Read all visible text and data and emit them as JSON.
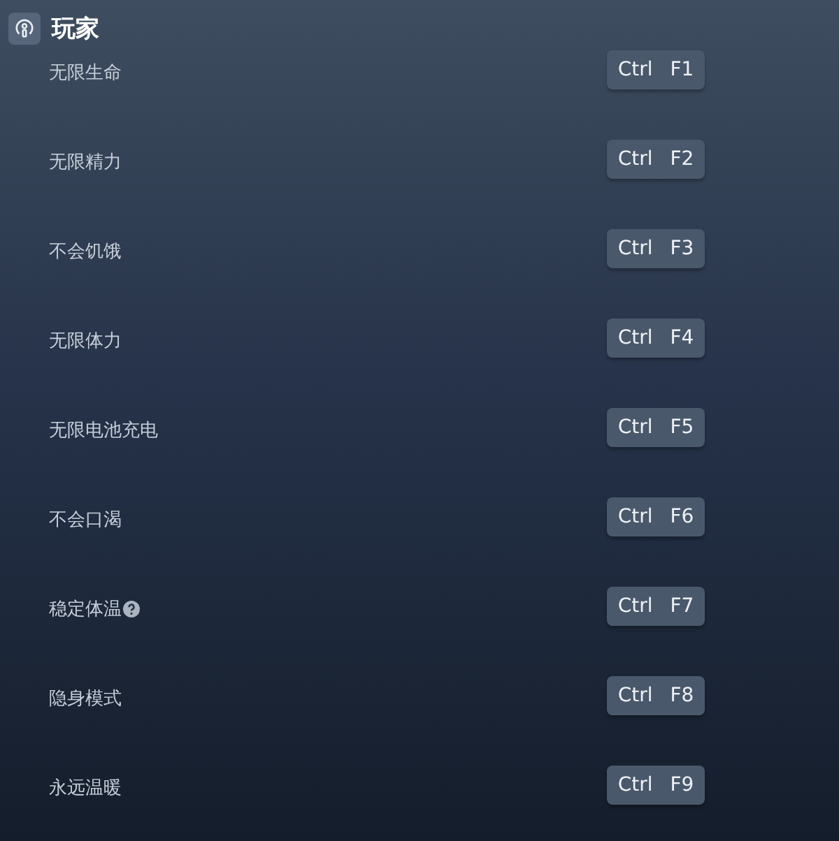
{
  "section": {
    "title": "玩家"
  },
  "cheats": [
    {
      "label": "无限生命",
      "hotkey": "Ctrl F1",
      "help": false
    },
    {
      "label": "无限精力",
      "hotkey": "Ctrl F2",
      "help": false
    },
    {
      "label": "不会饥饿",
      "hotkey": "Ctrl F3",
      "help": false
    },
    {
      "label": "无限体力",
      "hotkey": "Ctrl F4",
      "help": false
    },
    {
      "label": "无限电池充电",
      "hotkey": "Ctrl F5",
      "help": false
    },
    {
      "label": "不会口渴",
      "hotkey": "Ctrl F6",
      "help": false
    },
    {
      "label": "稳定体温",
      "hotkey": "Ctrl F7",
      "help": true
    },
    {
      "label": "隐身模式",
      "hotkey": "Ctrl F8",
      "help": false
    },
    {
      "label": "永远温暖",
      "hotkey": "Ctrl F9",
      "help": false
    }
  ]
}
